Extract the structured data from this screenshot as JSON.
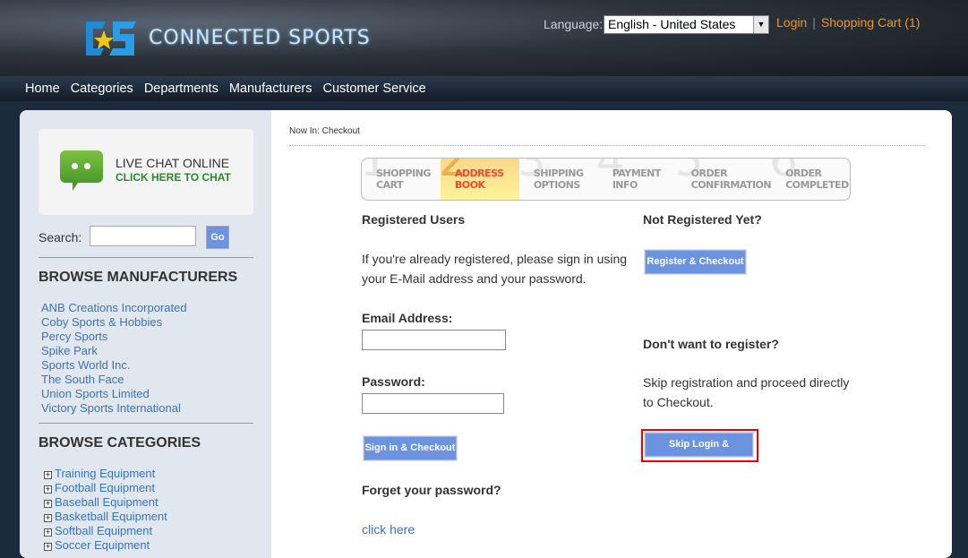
{
  "header": {
    "brand": "CONNECTED SPORTS",
    "language_label": "Language:",
    "language_value": "English - United States",
    "login": "Login",
    "cart": "Shopping Cart (1)"
  },
  "nav": [
    "Home",
    "Categories",
    "Departments",
    "Manufacturers",
    "Customer Service"
  ],
  "sidebar": {
    "chat_line1": "LIVE CHAT ONLINE",
    "chat_line2": "CLICK HERE TO CHAT",
    "search_label": "Search:",
    "search_value": "",
    "go": "Go",
    "manufacturers_title": "BROWSE MANUFACTURERS",
    "manufacturers": [
      "ANB Creations Incorporated",
      "Coby Sports & Hobbies",
      "Percy Sports",
      "Spike Park",
      "Sports World Inc.",
      "The South Face",
      "Union Sports Limited",
      "Victory Sports International"
    ],
    "categories_title": "BROWSE CATEGORIES",
    "categories": [
      "Training Equipment",
      "Football Equipment",
      "Baseball Equipment",
      "Basketball Equipment",
      "Softball Equipment",
      "Soccer Equipment"
    ]
  },
  "main": {
    "breadcrumb": "Now In: Checkout",
    "steps": [
      {
        "n": "1",
        "l1": "SHOPPING",
        "l2": "CART"
      },
      {
        "n": "2",
        "l1": "ADDRESS",
        "l2": "BOOK"
      },
      {
        "n": "3",
        "l1": "SHIPPING",
        "l2": "OPTIONS"
      },
      {
        "n": "4",
        "l1": "PAYMENT",
        "l2": "INFO"
      },
      {
        "n": "5",
        "l1": "ORDER",
        "l2": "CONFIRMATION"
      },
      {
        "n": "6",
        "l1": "ORDER",
        "l2": "COMPLETED"
      }
    ],
    "registered_title": "Registered Users",
    "registered_text": "If you're already registered, please sign in using your E-Mail address and your password.",
    "email_label": "Email Address:",
    "email_value": "",
    "password_label": "Password:",
    "password_value": "",
    "signin": "Sign in & Checkout",
    "forgot_title": "Forget your password?",
    "forgot_link": "click here",
    "notreg_title": "Not Registered Yet?",
    "register": "Register & Checkout",
    "noreg_title": "Don't want to register?",
    "noreg_text": "Skip registration and proceed directly to Checkout.",
    "skip": "Skip Login & Checkout"
  }
}
